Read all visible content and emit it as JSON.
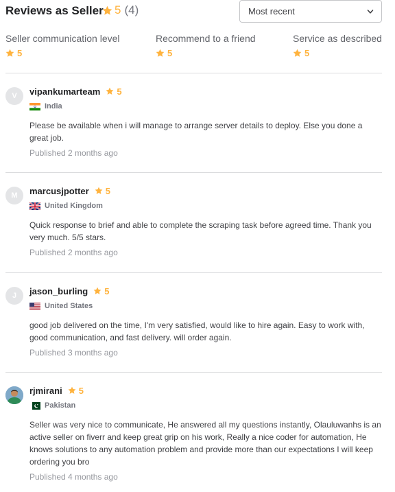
{
  "header": {
    "title": "Reviews as Seller",
    "score": "5",
    "count": "(4)",
    "star_icon": "star-icon",
    "star_color": "#ffb33e"
  },
  "sort": {
    "selected": "Most recent",
    "icon": "chevron-down-icon"
  },
  "breakdown": [
    {
      "label": "Seller communication level",
      "score": "5"
    },
    {
      "label": "Recommend to a friend",
      "score": "5"
    },
    {
      "label": "Service as described",
      "score": "5"
    }
  ],
  "reviews": [
    {
      "avatar_initial": "V",
      "username": "vipankumarteam",
      "score": "5",
      "country": "India",
      "flag": "india-flag",
      "text": "Please be available when i will manage to arrange server details to deploy. Else you done a great job.",
      "published": "Published 2 months ago"
    },
    {
      "avatar_initial": "M",
      "username": "marcusjpotter",
      "score": "5",
      "country": "United Kingdom",
      "flag": "united-kingdom-flag",
      "text": "Quick response to brief and able to complete the scraping task before agreed time. Thank you very much. 5/5 stars.",
      "published": "Published 2 months ago"
    },
    {
      "avatar_initial": "J",
      "username": "jason_burling",
      "score": "5",
      "country": "United States",
      "flag": "united-states-flag",
      "text": "good job delivered on the time, I'm very satisfied, would like to hire again. Easy to work with, good communication, and fast delivery. will order again.",
      "published": "Published 3 months ago"
    },
    {
      "avatar_initial": "",
      "username": "rjmirani",
      "score": "5",
      "country": "Pakistan",
      "flag": "pakistan-flag",
      "text": "Seller was very nice to communicate, He answered all my questions instantly, Olauluwanhs is an active seller on fiverr and keep great grip on his work, Really a nice coder for automation, He knows solutions to any automation problem and provide more than our expectations I will keep ordering you bro",
      "published": "Published 4 months ago"
    }
  ]
}
